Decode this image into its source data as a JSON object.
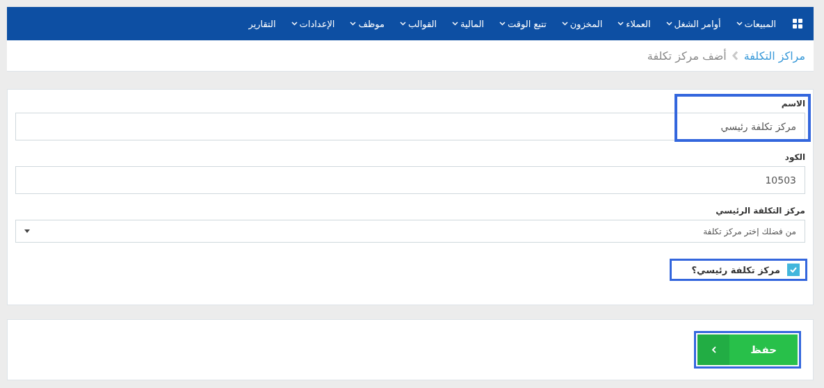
{
  "nav": {
    "items": [
      {
        "label": "المبيعات",
        "dropdown": true
      },
      {
        "label": "أوامر الشغل",
        "dropdown": true
      },
      {
        "label": "العملاء",
        "dropdown": true
      },
      {
        "label": "المخزون",
        "dropdown": true
      },
      {
        "label": "تتبع الوقت",
        "dropdown": true
      },
      {
        "label": "المالية",
        "dropdown": true
      },
      {
        "label": "القوالب",
        "dropdown": true
      },
      {
        "label": "موظف",
        "dropdown": true
      },
      {
        "label": "الإعدادات",
        "dropdown": true
      },
      {
        "label": "التقارير",
        "dropdown": false
      }
    ]
  },
  "breadcrumb": {
    "parent": "مراكز التكلفة",
    "current": "أضف مركز تكلفة"
  },
  "form": {
    "fields": [
      {
        "kind": "text",
        "label": "الاسم",
        "value": "مركز تكلفة رئيسي",
        "highlighted": true
      },
      {
        "kind": "text",
        "label": "الكود",
        "value": "10503",
        "highlighted": false
      },
      {
        "kind": "select",
        "label": "مركز التكلفة الرئيسي",
        "placeholder": "من فضلك إختر مركز تكلفة",
        "highlighted": false
      },
      {
        "kind": "checkbox",
        "label": "مركز تكلفة رئيسي؟",
        "checked": true,
        "highlighted": true
      }
    ]
  },
  "save_button": {
    "label": "حفظ",
    "highlighted": true
  }
}
